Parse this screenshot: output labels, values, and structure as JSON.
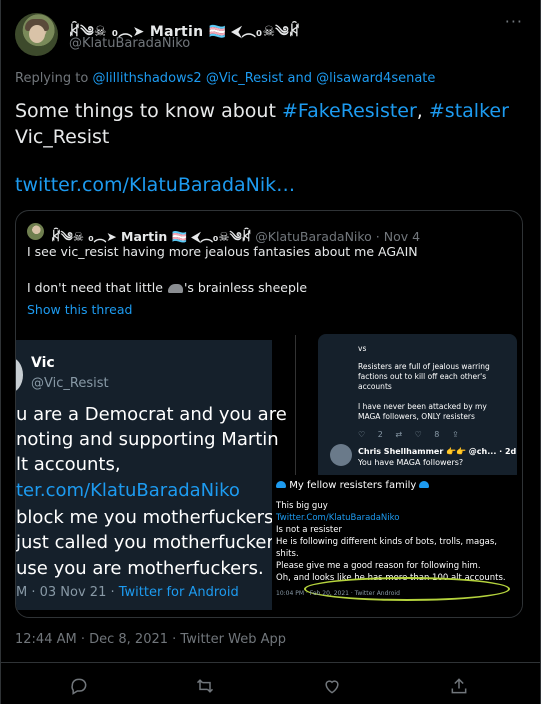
{
  "tweet": {
    "display_name": "ꊜ༄☠︎︎ ︎₀︎︵︎︎➤︎ Martin 🏳️‍⚧️ ⮜︎︵︎₀︎☠︎༄ꊜ",
    "handle": "@KlatuBaradaNiko",
    "more_label": "···",
    "replying_prefix": "Replying to",
    "replying_to": "@lillithshadows2 @Vic_Resist and @lisaward4senate",
    "text_part1": "Some things to know about",
    "hashtag1": "#FakeResister",
    "comma": ",",
    "hashtag2": "#stalker",
    "text_part2": "Vic_Resist",
    "link": "twitter.com/KlatuBaradaNik…",
    "timestamp": "12:44 AM · Dec 8, 2021 · Twitter Web App"
  },
  "quote": {
    "display_name": "ꊜ༄☠︎︎ ︎₀︎︵︎︎➤︎ Martin 🏳️‍⚧️ ⮜︎︵︎₀︎☠︎༄ꊜ",
    "handle_date": "@KlatuBaradaNiko · Nov 4",
    "line1": "I see vic_resist having more jealous fantasies about me AGAIN",
    "line2_a": "I don't need that little",
    "line2_b": "'s brainless  sheeple",
    "show_thread": "Show this thread"
  },
  "image_left": {
    "name": "Vic",
    "handle": "@Vic_Resist",
    "lines": [
      "u are a Democrat and you are",
      "noting and supporting Martin",
      "lt accounts,",
      "ter.com/KlatuBaradaNiko",
      "block me you motherfuckers",
      "just called you motherfucker",
      "use you are motherfuckers."
    ],
    "footer_date": "M · 03 Nov 21 ·",
    "footer_app": "Twitter for Android"
  },
  "image_right_top": {
    "vs": "vs",
    "p1": "Resisters are full of jealous warring factions out to kill off each other's accounts",
    "p2": "I have never been attacked by my MAGA followers, ONLY resisters",
    "icons": "♡ 2   ⇄   ♡ 8   ⇪",
    "reply_name": "Chris Shellhammer 👉👉 @ch... · 2d ···",
    "reply_msg": "You have MAGA followers?"
  },
  "image_right_bottom": {
    "header": "My fellow resisters family",
    "lines": [
      "This big guy",
      "Twitter.Com/KlatuBaradaNiko",
      "Is not a resister",
      "He is following different kinds of bots, trolls, magas,",
      "shits.",
      "Please give me a good reason for following him.",
      "Oh, and looks like he has more than 100 alt accounts."
    ],
    "footer": "10:04 PM · Feb 20, 2021 · Twitter Android"
  },
  "colors": {
    "background": "#000000",
    "text": "#e7e9ea",
    "muted": "#71767b",
    "accent": "#1d9bf0",
    "border": "#2f3336"
  },
  "actions": [
    "reply-icon",
    "retweet-icon",
    "like-icon",
    "share-icon"
  ]
}
